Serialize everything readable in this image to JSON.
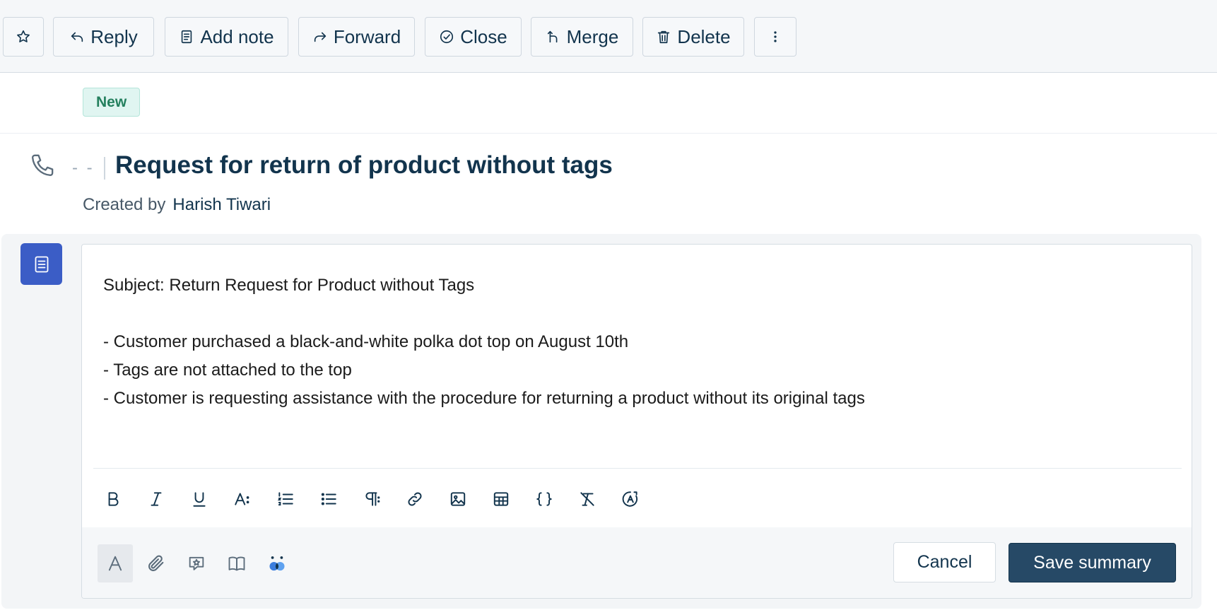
{
  "toolbar": {
    "buttons": [
      {
        "id": "star",
        "label": "",
        "icon": "star-icon"
      },
      {
        "id": "reply",
        "label": "Reply",
        "icon": "reply-icon"
      },
      {
        "id": "add_note",
        "label": "Add note",
        "icon": "note-icon"
      },
      {
        "id": "forward",
        "label": "Forward",
        "icon": "forward-icon"
      },
      {
        "id": "close",
        "label": "Close",
        "icon": "check-circle-icon"
      },
      {
        "id": "merge",
        "label": "Merge",
        "icon": "merge-icon"
      },
      {
        "id": "delete",
        "label": "Delete",
        "icon": "trash-icon"
      },
      {
        "id": "more",
        "label": "",
        "icon": "more-vertical-icon"
      }
    ]
  },
  "ticket": {
    "status": "New",
    "channel_icon": "phone-icon",
    "id_placeholder": "- -",
    "title": "Request for return of product without tags",
    "created_by_label": "Created by",
    "created_by": "Harish Tiwari"
  },
  "summary": {
    "subject_line": "Subject: Return Request for Product without Tags",
    "bullets": [
      "- Customer purchased a black-and-white polka dot top on August 10th",
      "- Tags are not attached to the top",
      "- Customer is requesting assistance with the procedure for returning a product without its original tags"
    ]
  },
  "formatting_toolbar": [
    "bold-icon",
    "italic-icon",
    "underline-icon",
    "font-size-icon",
    "ordered-list-icon",
    "bullet-list-icon",
    "paragraph-icon",
    "link-icon",
    "image-icon",
    "table-icon",
    "code-icon",
    "clear-format-icon",
    "spellcheck-icon"
  ],
  "footer": {
    "tools": [
      "text-format-icon",
      "attachment-icon",
      "canned-response-icon",
      "knowledge-base-icon",
      "freddy-ai-icon"
    ],
    "cancel_label": "Cancel",
    "save_label": "Save summary"
  },
  "colors": {
    "primary_button": "#264966",
    "note_icon_bg": "#3b5dc6",
    "status_badge_bg": "#e0f5f1",
    "status_badge_text": "#24805e"
  }
}
